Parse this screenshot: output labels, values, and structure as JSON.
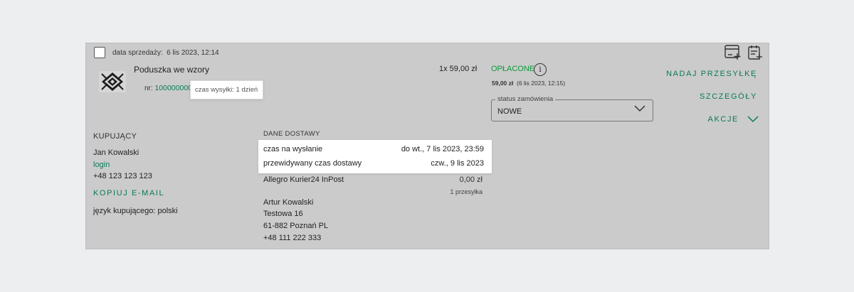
{
  "order": {
    "sale_date_label": "data sprzedaży:",
    "sale_date": "6 lis 2023, 12:14",
    "product_name": "Poduszka we wzory",
    "nr_label": "nr:",
    "nr_value": "10000000045",
    "shipping_tooltip": "czas wysyłki: 1 dzień",
    "qty_price": "1x 59,00 zł",
    "payment_status": "OPŁACONE",
    "paid_amount": "59,00 zł",
    "paid_date": "(6 lis 2023, 12:15)",
    "status_legend": "status zamówienia",
    "status_value": "NOWE"
  },
  "actions": {
    "ship": "NADAJ PRZESYŁKĘ",
    "details": "SZCZEGÓŁY",
    "more": "AKCJE"
  },
  "buyer": {
    "header": "KUPUJĄCY",
    "name": "Jan Kowalski",
    "login": "login",
    "phone": "+48 123 123 123",
    "copy_email": "KOPIUJ E-MAIL",
    "language": "język kupującego: polski"
  },
  "delivery": {
    "header": "DANE DOSTAWY",
    "send_by_label": "czas na wysłanie",
    "send_by_value": "do wt., 7 lis 2023, 23:59",
    "expected_label": "przewidywany czas dostawy",
    "expected_value": "czw., 9 lis 2023",
    "carrier": "Allegro Kurier24 InPost",
    "carrier_price": "0,00 zł",
    "shipments": "1 przesyłka",
    "address": [
      "Artur Kowalski",
      "Testowa 16",
      "61-882 Poznań PL",
      "+48 111 222 333"
    ]
  },
  "icons": {
    "info": "info-icon",
    "chevron": "chevron-down-icon",
    "add_invoice": "invoice-add-icon",
    "add_note": "note-add-icon"
  },
  "colors": {
    "accent": "#0a7a5a",
    "paid": "#0a9a3a",
    "card": "#cbcbcb",
    "page": "#eceef0"
  }
}
